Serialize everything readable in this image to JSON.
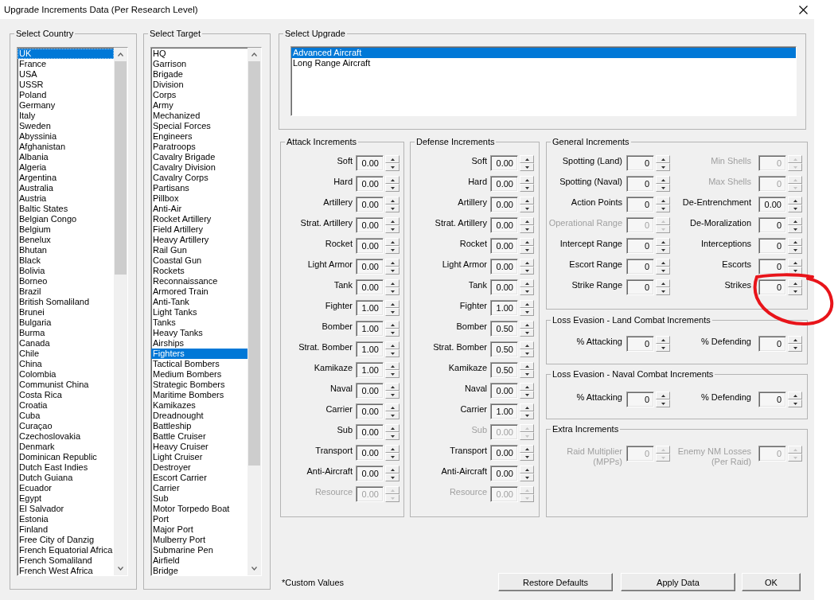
{
  "window": {
    "title": "Upgrade Increments Data (Per Research Level)"
  },
  "country_list": {
    "title": "Select Country",
    "focused": true,
    "items": [
      {
        "label": "UK",
        "selected": true
      },
      {
        "label": "France",
        "selected": false
      },
      {
        "label": "USA",
        "selected": false
      },
      {
        "label": "USSR",
        "selected": false
      },
      {
        "label": "Poland",
        "selected": false
      },
      {
        "label": "Germany",
        "selected": false
      },
      {
        "label": "Italy",
        "selected": false
      },
      {
        "label": "Sweden",
        "selected": false
      },
      {
        "label": "Abyssinia",
        "selected": false
      },
      {
        "label": "Afghanistan",
        "selected": false
      },
      {
        "label": "Albania",
        "selected": false
      },
      {
        "label": "Algeria",
        "selected": false
      },
      {
        "label": "Argentina",
        "selected": false
      },
      {
        "label": "Australia",
        "selected": false
      },
      {
        "label": "Austria",
        "selected": false
      },
      {
        "label": "Baltic States",
        "selected": false
      },
      {
        "label": "Belgian Congo",
        "selected": false
      },
      {
        "label": "Belgium",
        "selected": false
      },
      {
        "label": "Benelux",
        "selected": false
      },
      {
        "label": "Bhutan",
        "selected": false
      },
      {
        "label": "Black",
        "selected": false
      },
      {
        "label": "Bolivia",
        "selected": false
      },
      {
        "label": "Borneo",
        "selected": false
      },
      {
        "label": "Brazil",
        "selected": false
      },
      {
        "label": "British Somaliland",
        "selected": false
      },
      {
        "label": "Brunei",
        "selected": false
      },
      {
        "label": "Bulgaria",
        "selected": false
      },
      {
        "label": "Burma",
        "selected": false
      },
      {
        "label": "Canada",
        "selected": false
      },
      {
        "label": "Chile",
        "selected": false
      },
      {
        "label": "China",
        "selected": false
      },
      {
        "label": "Colombia",
        "selected": false
      },
      {
        "label": "Communist China",
        "selected": false
      },
      {
        "label": "Costa Rica",
        "selected": false
      },
      {
        "label": "Croatia",
        "selected": false
      },
      {
        "label": "Cuba",
        "selected": false
      },
      {
        "label": "Curaçao",
        "selected": false
      },
      {
        "label": "Czechoslovakia",
        "selected": false
      },
      {
        "label": "Denmark",
        "selected": false
      },
      {
        "label": "Dominican Republic",
        "selected": false
      },
      {
        "label": "Dutch East Indies",
        "selected": false
      },
      {
        "label": "Dutch Guiana",
        "selected": false
      },
      {
        "label": "Ecuador",
        "selected": false
      },
      {
        "label": "Egypt",
        "selected": false
      },
      {
        "label": "El Salvador",
        "selected": false
      },
      {
        "label": "Estonia",
        "selected": false
      },
      {
        "label": "Finland",
        "selected": false
      },
      {
        "label": "Free City of Danzig",
        "selected": false
      },
      {
        "label": "French Equatorial Africa",
        "selected": false
      },
      {
        "label": "French Somaliland",
        "selected": false
      },
      {
        "label": "French West Africa",
        "selected": false
      }
    ]
  },
  "target_list": {
    "title": "Select Target",
    "focused": false,
    "items": [
      {
        "label": "HQ",
        "selected": false
      },
      {
        "label": "Garrison",
        "selected": false
      },
      {
        "label": "Brigade",
        "selected": false
      },
      {
        "label": "Division",
        "selected": false
      },
      {
        "label": "Corps",
        "selected": false
      },
      {
        "label": "Army",
        "selected": false
      },
      {
        "label": "Mechanized",
        "selected": false
      },
      {
        "label": "Special Forces",
        "selected": false
      },
      {
        "label": "Engineers",
        "selected": false
      },
      {
        "label": "Paratroops",
        "selected": false
      },
      {
        "label": "Cavalry Brigade",
        "selected": false
      },
      {
        "label": "Cavalry Division",
        "selected": false
      },
      {
        "label": "Cavalry Corps",
        "selected": false
      },
      {
        "label": "Partisans",
        "selected": false
      },
      {
        "label": "Pillbox",
        "selected": false
      },
      {
        "label": "Anti-Air",
        "selected": false
      },
      {
        "label": "Rocket Artillery",
        "selected": false
      },
      {
        "label": "Field Artillery",
        "selected": false
      },
      {
        "label": "Heavy Artillery",
        "selected": false
      },
      {
        "label": "Rail Gun",
        "selected": false
      },
      {
        "label": "Coastal Gun",
        "selected": false
      },
      {
        "label": "Rockets",
        "selected": false
      },
      {
        "label": "Reconnaissance",
        "selected": false
      },
      {
        "label": "Armored Train",
        "selected": false
      },
      {
        "label": "Anti-Tank",
        "selected": false
      },
      {
        "label": "Light Tanks",
        "selected": false
      },
      {
        "label": "Tanks",
        "selected": false
      },
      {
        "label": "Heavy Tanks",
        "selected": false
      },
      {
        "label": "Airships",
        "selected": false
      },
      {
        "label": "Fighters",
        "selected": true
      },
      {
        "label": "Tactical Bombers",
        "selected": false
      },
      {
        "label": "Medium Bombers",
        "selected": false
      },
      {
        "label": "Strategic Bombers",
        "selected": false
      },
      {
        "label": "Maritime Bombers",
        "selected": false
      },
      {
        "label": "Kamikazes",
        "selected": false
      },
      {
        "label": "Dreadnought",
        "selected": false
      },
      {
        "label": "Battleship",
        "selected": false
      },
      {
        "label": "Battle Cruiser",
        "selected": false
      },
      {
        "label": "Heavy Cruiser",
        "selected": false
      },
      {
        "label": "Light Cruiser",
        "selected": false
      },
      {
        "label": "Destroyer",
        "selected": false
      },
      {
        "label": "Escort Carrier",
        "selected": false
      },
      {
        "label": "Carrier",
        "selected": false
      },
      {
        "label": "Sub",
        "selected": false
      },
      {
        "label": "Motor Torpedo Boat",
        "selected": false
      },
      {
        "label": "Port",
        "selected": false
      },
      {
        "label": "Major Port",
        "selected": false
      },
      {
        "label": "Mulberry Port",
        "selected": false
      },
      {
        "label": "Submarine Pen",
        "selected": false
      },
      {
        "label": "Airfield",
        "selected": false
      },
      {
        "label": "Bridge",
        "selected": false
      }
    ]
  },
  "upgrade_list": {
    "title": "Select Upgrade",
    "focused": false,
    "items": [
      {
        "label": "Advanced Aircraft",
        "selected": true
      },
      {
        "label": "Long Range Aircraft",
        "selected": false
      }
    ]
  },
  "attack_increments": {
    "title": "Attack Increments",
    "fields": [
      {
        "label": "Soft",
        "value": "0.00",
        "disabled": false
      },
      {
        "label": "Hard",
        "value": "0.00",
        "disabled": false
      },
      {
        "label": "Artillery",
        "value": "0.00",
        "disabled": false
      },
      {
        "label": "Strat. Artillery",
        "value": "0.00",
        "disabled": false
      },
      {
        "label": "Rocket",
        "value": "0.00",
        "disabled": false
      },
      {
        "label": "Light Armor",
        "value": "0.00",
        "disabled": false
      },
      {
        "label": "Tank",
        "value": "0.00",
        "disabled": false
      },
      {
        "label": "Fighter",
        "value": "1.00",
        "disabled": false
      },
      {
        "label": "Bomber",
        "value": "1.00",
        "disabled": false
      },
      {
        "label": "Strat. Bomber",
        "value": "1.00",
        "disabled": false
      },
      {
        "label": "Kamikaze",
        "value": "1.00",
        "disabled": false
      },
      {
        "label": "Naval",
        "value": "0.00",
        "disabled": false
      },
      {
        "label": "Carrier",
        "value": "0.00",
        "disabled": false
      },
      {
        "label": "Sub",
        "value": "0.00",
        "disabled": false
      },
      {
        "label": "Transport",
        "value": "0.00",
        "disabled": false
      },
      {
        "label": "Anti-Aircraft",
        "value": "0.00",
        "disabled": false
      },
      {
        "label": "Resource",
        "value": "0.00",
        "disabled": true
      }
    ]
  },
  "defense_increments": {
    "title": "Defense Increments",
    "fields": [
      {
        "label": "Soft",
        "value": "0.00",
        "disabled": false
      },
      {
        "label": "Hard",
        "value": "0.00",
        "disabled": false
      },
      {
        "label": "Artillery",
        "value": "0.00",
        "disabled": false
      },
      {
        "label": "Strat. Artillery",
        "value": "0.00",
        "disabled": false
      },
      {
        "label": "Rocket",
        "value": "0.00",
        "disabled": false
      },
      {
        "label": "Light Armor",
        "value": "0.00",
        "disabled": false
      },
      {
        "label": "Tank",
        "value": "0.00",
        "disabled": false
      },
      {
        "label": "Fighter",
        "value": "1.00",
        "disabled": false
      },
      {
        "label": "Bomber",
        "value": "0.50",
        "disabled": false
      },
      {
        "label": "Strat. Bomber",
        "value": "0.50",
        "disabled": false
      },
      {
        "label": "Kamikaze",
        "value": "0.50",
        "disabled": false
      },
      {
        "label": "Naval",
        "value": "0.00",
        "disabled": false
      },
      {
        "label": "Carrier",
        "value": "1.00",
        "disabled": false
      },
      {
        "label": "Sub",
        "value": "0.00",
        "disabled": true
      },
      {
        "label": "Transport",
        "value": "0.00",
        "disabled": false
      },
      {
        "label": "Anti-Aircraft",
        "value": "0.00",
        "disabled": false
      },
      {
        "label": "Resource",
        "value": "0.00",
        "disabled": true
      }
    ]
  },
  "general_increments": {
    "title": "General Increments",
    "fields": [
      {
        "label": "Spotting (Land)",
        "value": "0",
        "disabled": false,
        "circled": false
      },
      {
        "label": "Min Shells",
        "value": "0",
        "disabled": true,
        "circled": false
      },
      {
        "label": "Spotting (Naval)",
        "value": "0",
        "disabled": false,
        "circled": false
      },
      {
        "label": "Max Shells",
        "value": "0",
        "disabled": true,
        "circled": false
      },
      {
        "label": "Action Points",
        "value": "0",
        "disabled": false,
        "circled": false
      },
      {
        "label": "De-Entrenchment",
        "value": "0.00",
        "disabled": false,
        "circled": false
      },
      {
        "label": "Operational Range",
        "value": "0",
        "disabled": true,
        "circled": false
      },
      {
        "label": "De-Moralization",
        "value": "0",
        "disabled": false,
        "circled": false
      },
      {
        "label": "Intercept Range",
        "value": "0",
        "disabled": false,
        "circled": false
      },
      {
        "label": "Interceptions",
        "value": "0",
        "disabled": false,
        "circled": false
      },
      {
        "label": "Escort Range",
        "value": "0",
        "disabled": false,
        "circled": false
      },
      {
        "label": "Escorts",
        "value": "0",
        "disabled": false,
        "circled": false
      },
      {
        "label": "Strike Range",
        "value": "0",
        "disabled": false,
        "circled": false
      },
      {
        "label": "Strikes",
        "value": "0",
        "disabled": false,
        "circled": true
      }
    ]
  },
  "loss_evasion_land": {
    "title": "Loss Evasion - Land Combat Increments",
    "fields": [
      {
        "label": "% Attacking",
        "value": "0",
        "disabled": false
      },
      {
        "label": "% Defending",
        "value": "0",
        "disabled": false
      }
    ]
  },
  "loss_evasion_naval": {
    "title": "Loss Evasion - Naval Combat Increments",
    "fields": [
      {
        "label": "% Attacking",
        "value": "0",
        "disabled": false
      },
      {
        "label": "% Defending",
        "value": "0",
        "disabled": false
      }
    ]
  },
  "extra_increments": {
    "title": "Extra Increments",
    "fields": [
      {
        "label": "Raid Multiplier\n(MPPs)",
        "value": "0",
        "disabled": true
      },
      {
        "label": "Enemy NM Losses\n(Per Raid)",
        "value": "0",
        "disabled": true
      }
    ]
  },
  "footer": {
    "note": "*Custom Values",
    "buttons": [
      "Restore Defaults",
      "Apply Data",
      "OK"
    ]
  }
}
